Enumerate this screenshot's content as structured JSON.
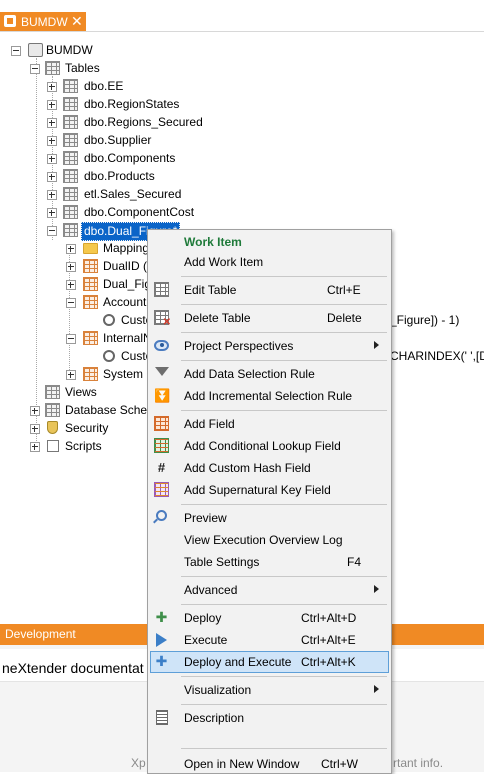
{
  "tab": {
    "title": "BUMDW",
    "close_glyph": "✕"
  },
  "tree": {
    "root": "BUMDW",
    "tables_label": "Tables",
    "tables": [
      "dbo.EE",
      "dbo.RegionStates",
      "dbo.Regions_Secured",
      "dbo.Supplier",
      "dbo.Components",
      "dbo.Products",
      "etl.Sales_Secured",
      "dbo.ComponentCost"
    ],
    "selected_table": "dbo.Dual_Figure*",
    "children": {
      "mappings": "Mappings",
      "dualid": "DualID (in",
      "dualfig": "Dual_Figu",
      "accountn": "AccountN",
      "custom1": "Custo",
      "internaln": "InternalN",
      "custom2": "Custo",
      "systemf": "System Fi"
    },
    "behind_text_1": "_Figure]) - 1)",
    "behind_text_2": "CHARINDEX(' ',[Du",
    "views": "Views",
    "database_schemas": "Database Schem",
    "security": "Security",
    "scripts": "Scripts"
  },
  "dev_bar": {
    "title": "Development"
  },
  "bottom": {
    "doc_text": "neXtender documentat",
    "foot_left": "Xp",
    "foot_right": "rtant info."
  },
  "menu": {
    "items": [
      {
        "label": "Work Item",
        "icon": "none",
        "bold": true
      },
      {
        "label": "Add Work Item",
        "icon": "none"
      },
      {
        "label": "Edit Table",
        "shortcut": "Ctrl+E",
        "icon": "edit-table-icon"
      },
      {
        "label": "Delete Table",
        "shortcut": "Delete",
        "icon": "delete-table-icon"
      },
      {
        "label": "Project Perspectives",
        "icon": "perspective-eye-icon",
        "submenu": true
      },
      {
        "label": "Add Data Selection Rule",
        "icon": "filter-icon"
      },
      {
        "label": "Add Incremental Selection Rule",
        "icon": "incremental-filter-icon"
      },
      {
        "label": "Add Field",
        "icon": "add-field-icon"
      },
      {
        "label": "Add Conditional Lookup Field",
        "icon": "lookup-field-icon"
      },
      {
        "label": "Add Custom Hash Field",
        "icon": "hash-field-icon"
      },
      {
        "label": "Add Supernatural Key Field",
        "icon": "supernatural-key-icon"
      },
      {
        "label": "Preview",
        "icon": "preview-icon"
      },
      {
        "label": "View Execution Overview Log",
        "icon": "none"
      },
      {
        "label": "Table Settings",
        "shortcut": "F4",
        "icon": "none"
      },
      {
        "label": "Advanced",
        "icon": "none",
        "submenu": true
      },
      {
        "label": "Deploy",
        "shortcut": "Ctrl+Alt+D",
        "icon": "deploy-icon"
      },
      {
        "label": "Execute",
        "shortcut": "Ctrl+Alt+E",
        "icon": "execute-icon"
      },
      {
        "label": "Deploy and Execute",
        "shortcut": "Ctrl+Alt+K",
        "icon": "deploy-execute-icon",
        "highlighted": true
      },
      {
        "label": "Visualization",
        "icon": "none",
        "submenu": true
      },
      {
        "label": "Description",
        "icon": "description-icon"
      },
      {
        "label": "Open in New Window",
        "shortcut": "Ctrl+W",
        "icon": "none"
      }
    ]
  },
  "colors": {
    "accent_orange": "#f08a24",
    "selection_blue": "#0a64c8",
    "menu_highlight": "#cfe4f8",
    "work_item_green": "#1f7a3a"
  }
}
